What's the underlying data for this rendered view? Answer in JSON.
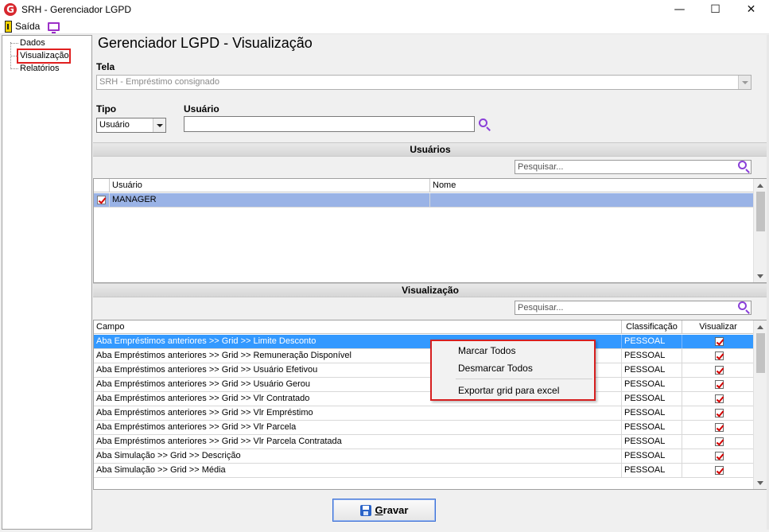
{
  "window": {
    "title": "SRH - Gerenciador LGPD",
    "minimize": "—",
    "maximize": "☐",
    "close": "✕"
  },
  "menu": {
    "exit_label": "Saída"
  },
  "tree": {
    "items": [
      {
        "label": "Dados",
        "selected": false
      },
      {
        "label": "Visualização",
        "selected": true
      },
      {
        "label": "Relatórios",
        "selected": false
      }
    ]
  },
  "main": {
    "title": "Gerenciador LGPD - Visualização",
    "tela_label": "Tela",
    "tela_value": "SRH - Empréstimo consignado",
    "tipo_label": "Tipo",
    "tipo_value": "Usuário",
    "usuario_label": "Usuário",
    "usuario_value": ""
  },
  "usuarios_section": {
    "header": "Usuários",
    "search_placeholder": "Pesquisar...",
    "columns": [
      "Usuário",
      "Nome"
    ],
    "rows": [
      {
        "checked": true,
        "usuario": "MANAGER",
        "nome": ""
      }
    ]
  },
  "visualizacao_section": {
    "header": "Visualização",
    "search_placeholder": "Pesquisar...",
    "columns": [
      "Campo",
      "Classificação",
      "Visualizar"
    ],
    "rows": [
      {
        "campo": "Aba Empréstimos anteriores >> Grid >> Limite Desconto",
        "classificacao": "PESSOAL",
        "visualizar": true
      },
      {
        "campo": "Aba Empréstimos anteriores >> Grid >> Remuneração Disponível",
        "classificacao": "PESSOAL",
        "visualizar": true
      },
      {
        "campo": "Aba Empréstimos anteriores >> Grid >> Usuário Efetivou",
        "classificacao": "PESSOAL",
        "visualizar": true
      },
      {
        "campo": "Aba Empréstimos anteriores >> Grid >> Usuário Gerou",
        "classificacao": "PESSOAL",
        "visualizar": true
      },
      {
        "campo": "Aba Empréstimos anteriores >> Grid >> Vlr Contratado",
        "classificacao": "PESSOAL",
        "visualizar": true
      },
      {
        "campo": "Aba Empréstimos anteriores >> Grid >> Vlr Empréstimo",
        "classificacao": "PESSOAL",
        "visualizar": true
      },
      {
        "campo": "Aba Empréstimos anteriores >> Grid >> Vlr Parcela",
        "classificacao": "PESSOAL",
        "visualizar": true
      },
      {
        "campo": "Aba Empréstimos anteriores >> Grid >> Vlr Parcela Contratada",
        "classificacao": "PESSOAL",
        "visualizar": true
      },
      {
        "campo": "Aba Simulação >> Grid >> Descrição",
        "classificacao": "PESSOAL",
        "visualizar": true
      },
      {
        "campo": "Aba Simulação >> Grid >> Média",
        "classificacao": "PESSOAL",
        "visualizar": true
      }
    ]
  },
  "context_menu": {
    "items": [
      "Marcar Todos",
      "Desmarcar Todos",
      "Exportar grid para excel"
    ]
  },
  "save_button": {
    "label_underlined": "G",
    "label_rest": "ravar"
  }
}
